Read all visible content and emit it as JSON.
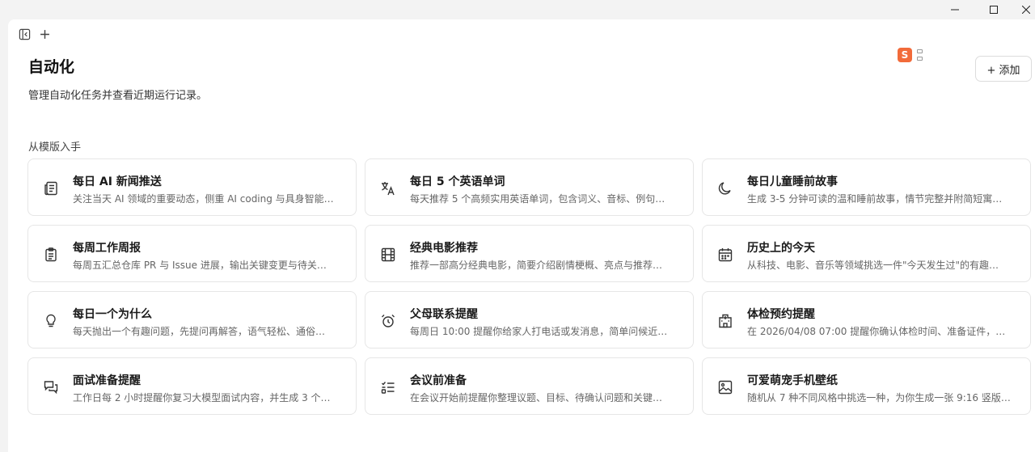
{
  "window": {
    "minimize": "—",
    "maximize": "☐",
    "close": "✕"
  },
  "toolbar": {
    "new_tab": "+"
  },
  "header": {
    "title": "自动化",
    "subtitle": "管理自动化任务并查看近期运行记录。",
    "add_label": "+ 添加",
    "badge_letter": "S"
  },
  "section": {
    "label": "从模版入手"
  },
  "templates": [
    {
      "title": "每日 AI 新闻推送",
      "desc": "关注当天 AI 领域的重要动态，侧重 AI coding 与具身智能…",
      "icon": "newspaper-icon"
    },
    {
      "title": "每日 5 个英语单词",
      "desc": "每天推荐 5 个高频实用英语单词，包含词义、音标、例句…",
      "icon": "translate-icon"
    },
    {
      "title": "每日儿童睡前故事",
      "desc": "生成 3-5 分钟可读的温和睡前故事，情节完整并附简短寓…",
      "icon": "moon-icon"
    },
    {
      "title": "每周工作周报",
      "desc": "每周五汇总仓库 PR 与 Issue 进展，输出关键变更与待关…",
      "icon": "clipboard-icon"
    },
    {
      "title": "经典电影推荐",
      "desc": "推荐一部高分经典电影，简要介绍剧情梗概、亮点与推荐…",
      "icon": "film-icon"
    },
    {
      "title": "历史上的今天",
      "desc": "从科技、电影、音乐等领域挑选一件\"今天发生过\"的有趣…",
      "icon": "calendar-icon"
    },
    {
      "title": "每日一个为什么",
      "desc": "每天抛出一个有趣问题，先提问再解答，语气轻松、通俗…",
      "icon": "lightbulb-icon"
    },
    {
      "title": "父母联系提醒",
      "desc": "每周日 10:00 提醒你给家人打电话或发消息，简单问候近…",
      "icon": "alarm-clock-icon"
    },
    {
      "title": "体检预约提醒",
      "desc": "在 2026/04/08 07:00 提醒你确认体检时间、准备证件，并…",
      "icon": "hospital-icon"
    },
    {
      "title": "面试准备提醒",
      "desc": "工作日每 2 小时提醒你复习大模型面试内容，并生成 3 个…",
      "icon": "chat-bubbles-icon"
    },
    {
      "title": "会议前准备",
      "desc": "在会议开始前提醒你整理议题、目标、待确认问题和关键…",
      "icon": "checklist-icon"
    },
    {
      "title": "可爱萌宠手机壁纸",
      "desc": "随机从 7 种不同风格中挑选一种，为你生成一张 9:16 竖版…",
      "icon": "image-icon"
    }
  ]
}
